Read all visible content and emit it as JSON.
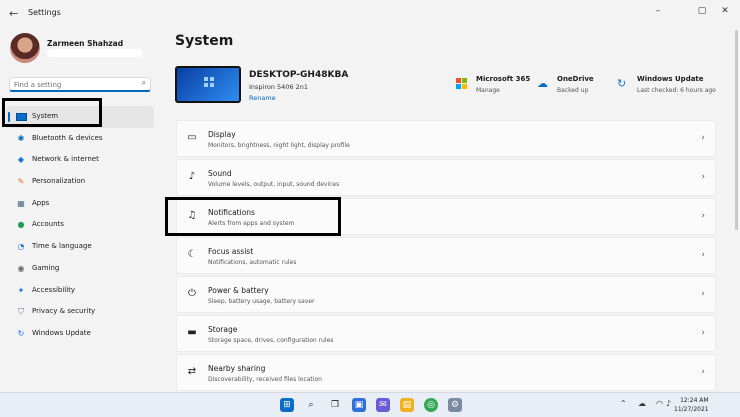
{
  "window": {
    "title": "Settings",
    "back_icon": "back-arrow-icon",
    "minimize": "–",
    "maximize": "▢",
    "close": "✕"
  },
  "user": {
    "name": "Zarmeen Shahzad"
  },
  "search": {
    "placeholder": "Find a setting",
    "icon": "search-icon"
  },
  "sidebar": {
    "items": [
      {
        "label": "System",
        "icon": "system-icon",
        "active": true
      },
      {
        "label": "Bluetooth & devices",
        "icon": "bluetooth-icon"
      },
      {
        "label": "Network & internet",
        "icon": "network-icon"
      },
      {
        "label": "Personalization",
        "icon": "brush-icon"
      },
      {
        "label": "Apps",
        "icon": "apps-icon"
      },
      {
        "label": "Accounts",
        "icon": "accounts-icon"
      },
      {
        "label": "Time & language",
        "icon": "globe-clock-icon"
      },
      {
        "label": "Gaming",
        "icon": "gamepad-icon"
      },
      {
        "label": "Accessibility",
        "icon": "accessibility-icon"
      },
      {
        "label": "Privacy & security",
        "icon": "shield-icon"
      },
      {
        "label": "Windows Update",
        "icon": "update-icon"
      }
    ]
  },
  "main": {
    "title": "System",
    "device": {
      "name": "DESKTOP-GH48KBA",
      "model": "Inspiron 5406 2n1",
      "rename": "Rename"
    },
    "quick": [
      {
        "title": "Microsoft 365",
        "sub": "Manage",
        "icon": "microsoft-icon"
      },
      {
        "title": "OneDrive",
        "sub": "Backed up",
        "icon": "cloud-icon"
      },
      {
        "title": "Windows Update",
        "sub": "Last checked: 6 hours ago",
        "icon": "update-icon"
      }
    ],
    "cards": [
      {
        "title": "Display",
        "sub": "Monitors, brightness, night light, display profile",
        "icon": "display-icon"
      },
      {
        "title": "Sound",
        "sub": "Volume levels, output, input, sound devices",
        "icon": "speaker-icon"
      },
      {
        "title": "Notifications",
        "sub": "Alerts from apps and system",
        "icon": "bell-icon"
      },
      {
        "title": "Focus assist",
        "sub": "Notifications, automatic rules",
        "icon": "moon-icon"
      },
      {
        "title": "Power & battery",
        "sub": "Sleep, battery usage, battery saver",
        "icon": "power-icon"
      },
      {
        "title": "Storage",
        "sub": "Storage space, drives, configuration rules",
        "icon": "storage-icon"
      },
      {
        "title": "Nearby sharing",
        "sub": "Discoverability, received files location",
        "icon": "share-icon"
      }
    ]
  },
  "taskbar": {
    "time": "12:24 AM",
    "date": "11/27/2021",
    "apps": [
      "start-icon",
      "search-icon",
      "task-view-icon",
      "widgets-icon",
      "chat-icon",
      "file-explorer-icon",
      "chrome-icon",
      "settings-icon"
    ]
  },
  "colors": {
    "accent": "#0067c0",
    "highlight_box": "#000000"
  }
}
